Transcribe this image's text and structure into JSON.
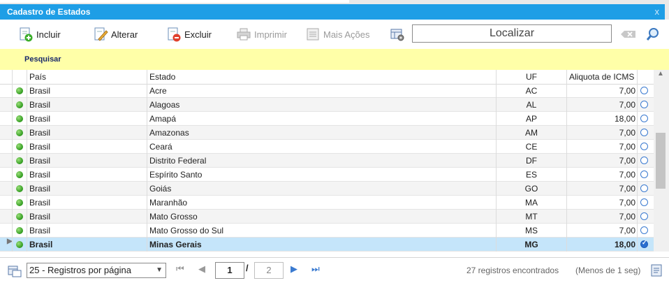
{
  "window": {
    "title": "Cadastro de Estados",
    "close_glyph": "x"
  },
  "toolbar": {
    "incluir": "Incluir",
    "alterar": "Alterar",
    "excluir": "Excluir",
    "imprimir": "Imprimir",
    "mais_acoes": "Mais Ações",
    "search_placeholder": "Localizar"
  },
  "filter": {
    "label": "Pesquisar"
  },
  "grid": {
    "columns": {
      "pais": "País",
      "estado": "Estado",
      "uf": "UF",
      "aliquota": "Aliquota de ICMS"
    },
    "rows": [
      {
        "pais": "Brasil",
        "estado": "Acre",
        "uf": "AC",
        "aliquota": "7,00"
      },
      {
        "pais": "Brasil",
        "estado": "Alagoas",
        "uf": "AL",
        "aliquota": "7,00"
      },
      {
        "pais": "Brasil",
        "estado": "Amapá",
        "uf": "AP",
        "aliquota": "18,00"
      },
      {
        "pais": "Brasil",
        "estado": "Amazonas",
        "uf": "AM",
        "aliquota": "7,00"
      },
      {
        "pais": "Brasil",
        "estado": "Ceará",
        "uf": "CE",
        "aliquota": "7,00"
      },
      {
        "pais": "Brasil",
        "estado": "Distrito Federal",
        "uf": "DF",
        "aliquota": "7,00"
      },
      {
        "pais": "Brasil",
        "estado": "Espírito Santo",
        "uf": "ES",
        "aliquota": "7,00"
      },
      {
        "pais": "Brasil",
        "estado": "Goiás",
        "uf": "GO",
        "aliquota": "7,00"
      },
      {
        "pais": "Brasil",
        "estado": "Maranhão",
        "uf": "MA",
        "aliquota": "7,00"
      },
      {
        "pais": "Brasil",
        "estado": "Mato Grosso",
        "uf": "MT",
        "aliquota": "7,00"
      },
      {
        "pais": "Brasil",
        "estado": "Mato Grosso do Sul",
        "uf": "MS",
        "aliquota": "7,00"
      },
      {
        "pais": "Brasil",
        "estado": "Minas Gerais",
        "uf": "MG",
        "aliquota": "18,00",
        "selected": true
      }
    ]
  },
  "footer": {
    "page_size": "25 - Registros por página",
    "current_page": "1",
    "separator": "/",
    "total_pages": "2",
    "records_found": "27 registros encontrados",
    "elapsed": "(Menos de 1 seg)"
  },
  "colors": {
    "title_bar": "#1e9ee6",
    "filter_bar": "#ffffa8",
    "selected_row": "#c5e5fa",
    "status_dot": "#2f9a1e"
  }
}
